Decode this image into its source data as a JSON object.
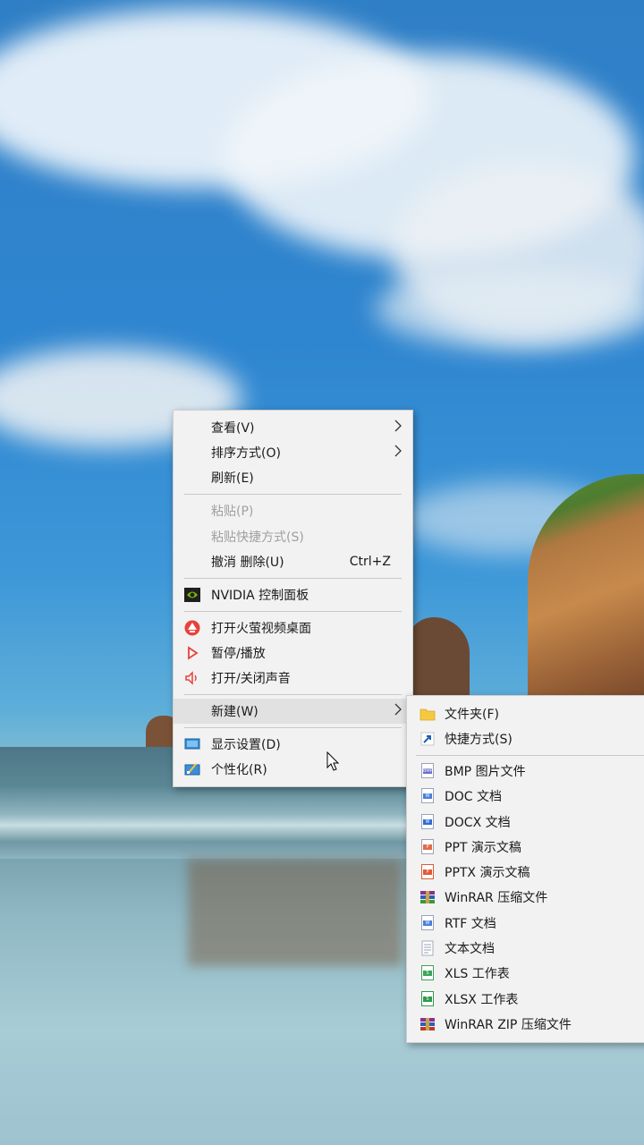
{
  "main_menu": {
    "items": [
      {
        "label": "查看(V)"
      },
      {
        "label": "排序方式(O)"
      },
      {
        "label": "刷新(E)"
      },
      {
        "label": "粘贴(P)"
      },
      {
        "label": "粘贴快捷方式(S)"
      },
      {
        "label": "撤消 删除(U)",
        "shortcut": "Ctrl+Z"
      },
      {
        "label": "NVIDIA 控制面板"
      },
      {
        "label": "打开火萤视频桌面"
      },
      {
        "label": "暂停/播放"
      },
      {
        "label": "打开/关闭声音"
      },
      {
        "label": "新建(W)"
      },
      {
        "label": "显示设置(D)"
      },
      {
        "label": "个性化(R)"
      }
    ]
  },
  "sub_menu": {
    "items": [
      {
        "label": "文件夹(F)",
        "icon": "folder-icon"
      },
      {
        "label": "快捷方式(S)",
        "icon": "shortcut-icon"
      },
      {
        "label": "BMP 图片文件",
        "icon": "bmp-file-icon",
        "badge": "BMP"
      },
      {
        "label": "DOC 文档",
        "icon": "doc-file-icon",
        "badge": "W"
      },
      {
        "label": "DOCX 文档",
        "icon": "docx-file-icon",
        "badge": "W"
      },
      {
        "label": "PPT 演示文稿",
        "icon": "ppt-file-icon",
        "badge": "P"
      },
      {
        "label": "PPTX 演示文稿",
        "icon": "pptx-file-icon",
        "badge": "P"
      },
      {
        "label": "WinRAR 压缩文件",
        "icon": "winrar-icon"
      },
      {
        "label": "RTF 文档",
        "icon": "rtf-file-icon",
        "badge": "W"
      },
      {
        "label": "文本文档",
        "icon": "text-file-icon"
      },
      {
        "label": "XLS 工作表",
        "icon": "xls-file-icon",
        "badge": "S"
      },
      {
        "label": "XLSX 工作表",
        "icon": "xlsx-file-icon",
        "badge": "S"
      },
      {
        "label": "WinRAR ZIP 压缩文件",
        "icon": "winrar-zip-icon"
      }
    ]
  },
  "colors": {
    "menu_bg": "#f2f2f2",
    "disabled_text": "#a0a0a0",
    "nvidia_green": "#76b900",
    "media_red": "#e8413c"
  }
}
